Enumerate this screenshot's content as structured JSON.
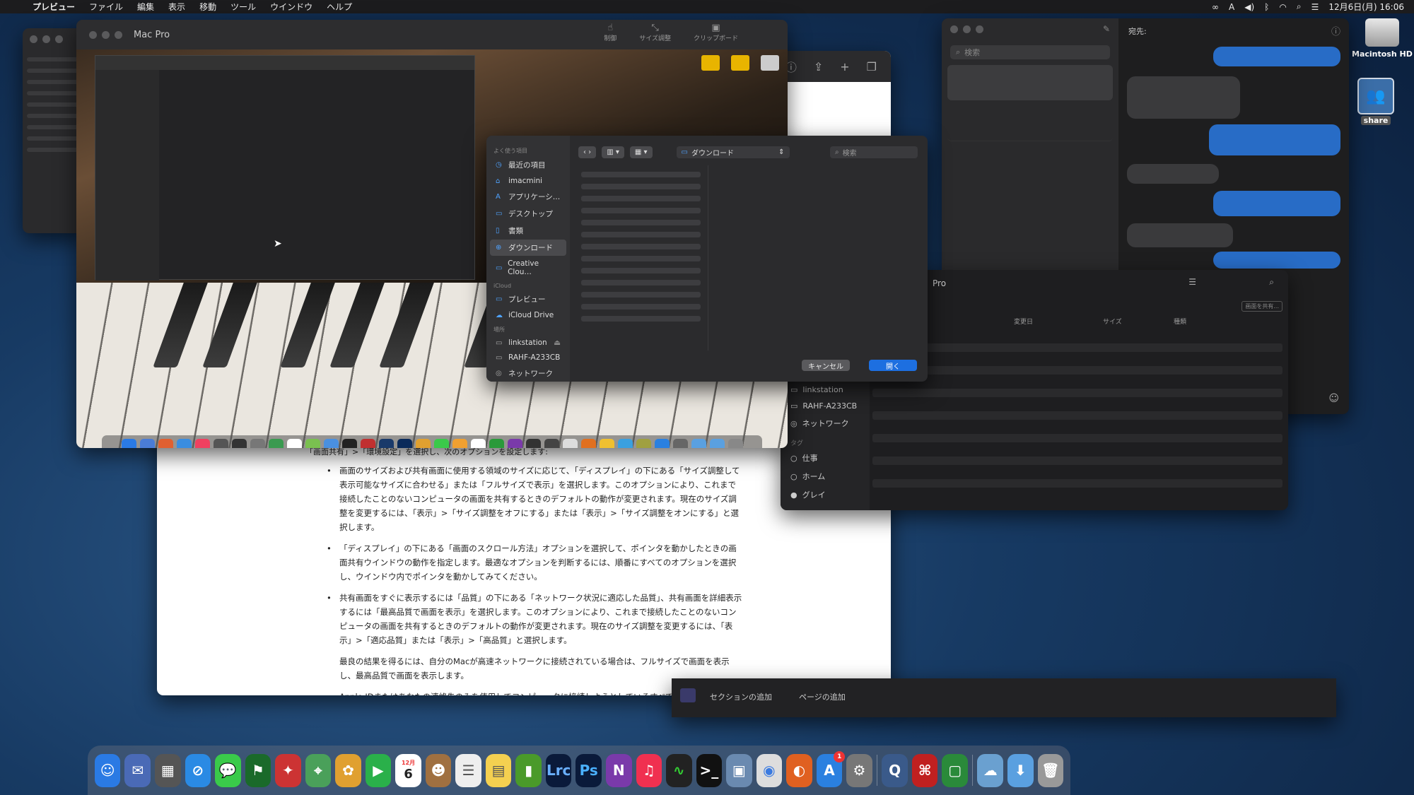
{
  "menubar": {
    "app": "プレビュー",
    "items": [
      "ファイル",
      "編集",
      "表示",
      "移動",
      "ツール",
      "ウインドウ",
      "ヘルプ"
    ],
    "clock": "12月6日(月) 16:06"
  },
  "desktop": {
    "hdd_label": "Macintosh HD",
    "share_label": "share"
  },
  "remote_window": {
    "title": "Mac Pro",
    "toolbar": [
      "制御",
      "サイズ調整",
      "クリップボード"
    ]
  },
  "open_dialog": {
    "favorites_caption": "よく使う項目",
    "favorites": [
      "最近の項目",
      "imacmini",
      "アプリケーシ…",
      "デスクトップ",
      "書類",
      "ダウンロード",
      "Creative Clou…"
    ],
    "icloud_caption": "iCloud",
    "icloud": [
      "プレビュー",
      "iCloud Drive"
    ],
    "places_caption": "場所",
    "places": [
      "linkstation",
      "RAHF-A233CB",
      "ネットワーク"
    ],
    "location": "ダウンロード",
    "search_placeholder": "検索",
    "cancel": "キャンセル",
    "open": "開く"
  },
  "finder": {
    "title_fragment": "Pro",
    "columns": [
      "変更日",
      "サイズ",
      "種類"
    ],
    "share_button": "画面を共有...",
    "places": [
      "linkstation",
      "RAHF-A233CB",
      "ネットワーク"
    ],
    "tags_caption": "タグ",
    "tags": [
      "仕事",
      "ホーム",
      "グレイ"
    ]
  },
  "messages": {
    "search_placeholder": "検索",
    "to_label": "宛先:"
  },
  "document": {
    "heading_fragment": "「画面共有」>「環境設定」を選択し、次のオプションを設定します:",
    "bullets": [
      "画面のサイズおよび共有画面に使用する領域のサイズに応じて、「ディスプレイ」の下にある「サイズ調整して表示可能なサイズに合わせる」または「フルサイズで表示」を選択します。このオプションにより、これまで接続したことのないコンピュータの画面を共有するときのデフォルトの動作が変更されます。現在のサイズ調整を変更するには、「表示」>「サイズ調整をオフにする」または「表示」>「サイズ調整をオンにする」と選択します。",
      "「ディスプレイ」の下にある「画面のスクロール方法」オプションを選択して、ポインタを動かしたときの画面共有ウインドウの動作を指定します。最適なオプションを判断するには、順番にすべてのオプションを選択し、ウインドウ内でポインタを動かしてみてください。",
      "共有画面をすぐに表示するには「品質」の下にある「ネットワーク状況に適応した品質」、共有画面を詳細表示するには「最高品質で画面を表示」を選択します。このオプションにより、これまで接続したことのないコンピュータの画面を共有するときのデフォルトの動作が変更されます。現在のサイズ調整を変更するには、「表示」>「適応品質」または「表示」>「高品質」と選択します。"
    ],
    "paragraph": "最良の結果を得るには、自分のMacが高速ネットワークに接続されている場合は、フルサイズで画面を表示し、最高品質で画面を表示します。",
    "last_bullet": "Apple IDまたはあなたの連絡先のみを使用してコンピュータに接続しようとしているすべての人と、画面を共有できるよ"
  },
  "notes_bar": {
    "add_section": "セクションの追加",
    "add_page": "ページの追加"
  },
  "dock": {
    "calendar_month": "12月",
    "calendar_day": "6",
    "appstore_badge": "1",
    "lrc": "Lrc",
    "ps": "Ps",
    "onenote": "N"
  }
}
